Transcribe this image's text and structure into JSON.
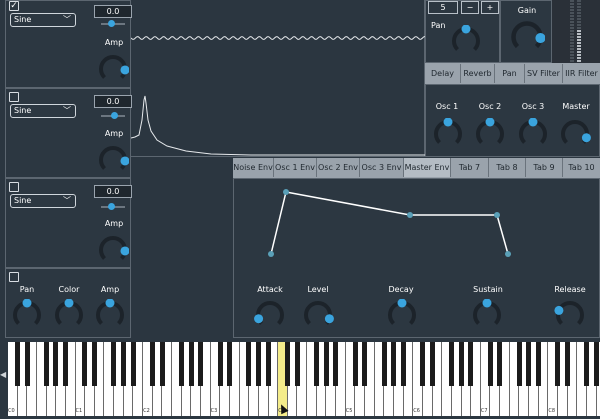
{
  "oscillators": [
    {
      "wave": "Sine",
      "value": "0.0",
      "amp_label": "Amp",
      "level": 0.2,
      "amp": 0.85
    },
    {
      "wave": "Sine",
      "value": "0.0",
      "amp_label": "Amp",
      "level": 0.35,
      "amp": 0.85
    },
    {
      "wave": "Sine",
      "value": "0.0",
      "amp_label": "Amp",
      "level": 0.2,
      "amp": 0.85
    }
  ],
  "noise": {
    "pan_label": "Pan",
    "color_label": "Color",
    "amp_label": "Amp",
    "pan": 0.5,
    "color": 0.5,
    "amp": 0.5
  },
  "top_right": {
    "number": "5",
    "minus": "−",
    "plus": "+",
    "pan_label": "Pan",
    "pan": 0.5,
    "gain_label": "Gain",
    "gain": 0.85
  },
  "fx_tabs": [
    "Delay",
    "Reverb",
    "Pan",
    "SV Filter",
    "IIR Filter"
  ],
  "mix": [
    {
      "label": "Osc 1",
      "value": 0.5
    },
    {
      "label": "Osc 2",
      "value": 0.5
    },
    {
      "label": "Osc 3",
      "value": 0.5
    },
    {
      "label": "Master",
      "value": 0.9
    }
  ],
  "env_tabs": [
    "Noise Env",
    "Osc 1 Env",
    "Osc 2 Env",
    "Osc 3 Env",
    "Master Env",
    "Tab 7",
    "Tab 8",
    "Tab 9",
    "Tab 10"
  ],
  "env_active_tab": 4,
  "env_controls": [
    {
      "label": "Attack",
      "value": 0.1
    },
    {
      "label": "Level",
      "value": 0.9
    },
    {
      "label": "Decay",
      "value": 0.5
    },
    {
      "label": "Sustain",
      "value": 0.5
    },
    {
      "label": "Release",
      "value": 0.25
    }
  ],
  "keyboard": {
    "octave_labels": [
      "C0",
      "C1",
      "C2",
      "C3",
      "C4",
      "C5",
      "C6",
      "C7",
      "C8"
    ],
    "highlighted_note": "C4",
    "scroll_left_icon": "triangle-left-icon"
  },
  "colors": {
    "accent": "#3aa4de",
    "background": "#2b3640"
  }
}
